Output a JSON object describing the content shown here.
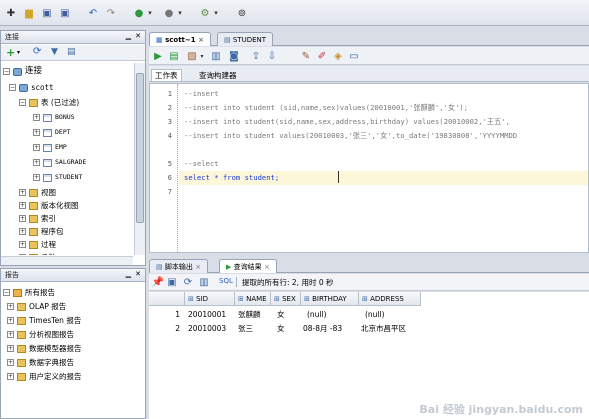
{
  "connections_panel": {
    "title": "连接",
    "root_label": "连接",
    "connection": "scott",
    "tables_node": "表 (已过滤)",
    "tables": [
      "BONUS",
      "DEPT",
      "EMP",
      "SALGRADE",
      "STUDENT"
    ],
    "other_nodes": [
      "视图",
      "版本化视图",
      "索引",
      "程序包",
      "过程",
      "函数"
    ]
  },
  "reports_panel": {
    "title": "报告",
    "items": [
      "所有报告",
      "OLAP 报告",
      "TimesTen 报告",
      "分析视图报告",
      "数据模型器报告",
      "数据字典报告",
      "用户定义的报告"
    ]
  },
  "editor": {
    "tabs": [
      "scott~1",
      "STUDENT"
    ],
    "subtabs": [
      "工作表",
      "查询构建器"
    ],
    "line_numbers": [
      "1",
      "2",
      "3",
      "4",
      "5",
      "6",
      "7"
    ],
    "lines": [
      "--insert",
      "--insert into student (sid,name,sex)values(20010001,'张麒麟','女');",
      "--insert into student(sid,name,sex,address,birthday) values(20010002,'王五',",
      "--insert into student values(20010003,'张三','女',to_date('19830808','YYYYMMDD",
      "",
      "--select",
      "select * from student;"
    ]
  },
  "output": {
    "tabs": [
      "脚本输出",
      "查询结果"
    ],
    "toolbar_sql": "SQL",
    "status": "提取的所有行: 2, 用时 0 秒",
    "columns": [
      "SID",
      "NAME",
      "SEX",
      "BIRTHDAY",
      "ADDRESS"
    ],
    "rows": [
      [
        "1",
        "20010001",
        "张麒麟",
        "女",
        "(null)",
        "(null)"
      ],
      [
        "2",
        "20010003",
        "张三",
        "女",
        "08-8月 -83",
        "北京市昌平区"
      ]
    ]
  },
  "watermark": "Bai 经验 jingyan.baidu.com"
}
